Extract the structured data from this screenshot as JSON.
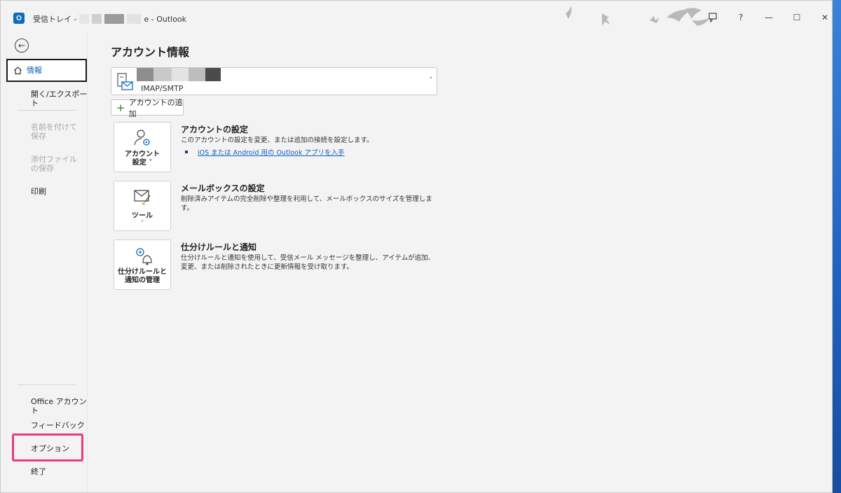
{
  "window": {
    "title_prefix": "受信トレイ -",
    "title_suffix": "e  -  Outlook"
  },
  "nav": {
    "back_icon": "back-arrow-icon",
    "items": [
      {
        "label": "情報",
        "state": "selected"
      },
      {
        "label": "開く/エクスポート",
        "state": "enabled"
      },
      {
        "label": "名前を付けて保存",
        "state": "disabled"
      },
      {
        "label": "添付ファイルの保存",
        "state": "disabled"
      },
      {
        "label": "印刷",
        "state": "enabled"
      }
    ],
    "bottom": [
      {
        "label": "Office アカウント"
      },
      {
        "label": "フィードバック"
      },
      {
        "label": "オプション"
      },
      {
        "label": "終了"
      }
    ]
  },
  "main": {
    "title": "アカウント情報",
    "account": {
      "type": "IMAP/SMTP"
    },
    "add_account": "アカウントの追加",
    "sections": [
      {
        "tile": [
          "アカウント",
          "設定 ˅"
        ],
        "title": "アカウントの設定",
        "desc": "このアカウントの設定を変更、または追加の接続を設定します。",
        "link": "iOS または Android 用の Outlook アプリを入手"
      },
      {
        "tile": [
          "ツール",
          "˅"
        ],
        "title": "メールボックスの設定",
        "desc": "削除済みアイテムの完全削除や整理を利用して、メールボックスのサイズを管理します。"
      },
      {
        "tile": [
          "仕分けルールと",
          "通知の管理"
        ],
        "title": "仕分けルールと通知",
        "desc": "仕分けルールと通知を使用して、受信メール メッセージを整理し、アイテムが追加、変更、または削除されたときに更新情報を受け取ります。"
      }
    ]
  },
  "titlebar_buttons": {
    "minimize": "—",
    "maximize": "☐",
    "close": "✕",
    "help": "?"
  },
  "colors": {
    "highlight": "#f1377c",
    "link": "#0f5fc2"
  }
}
